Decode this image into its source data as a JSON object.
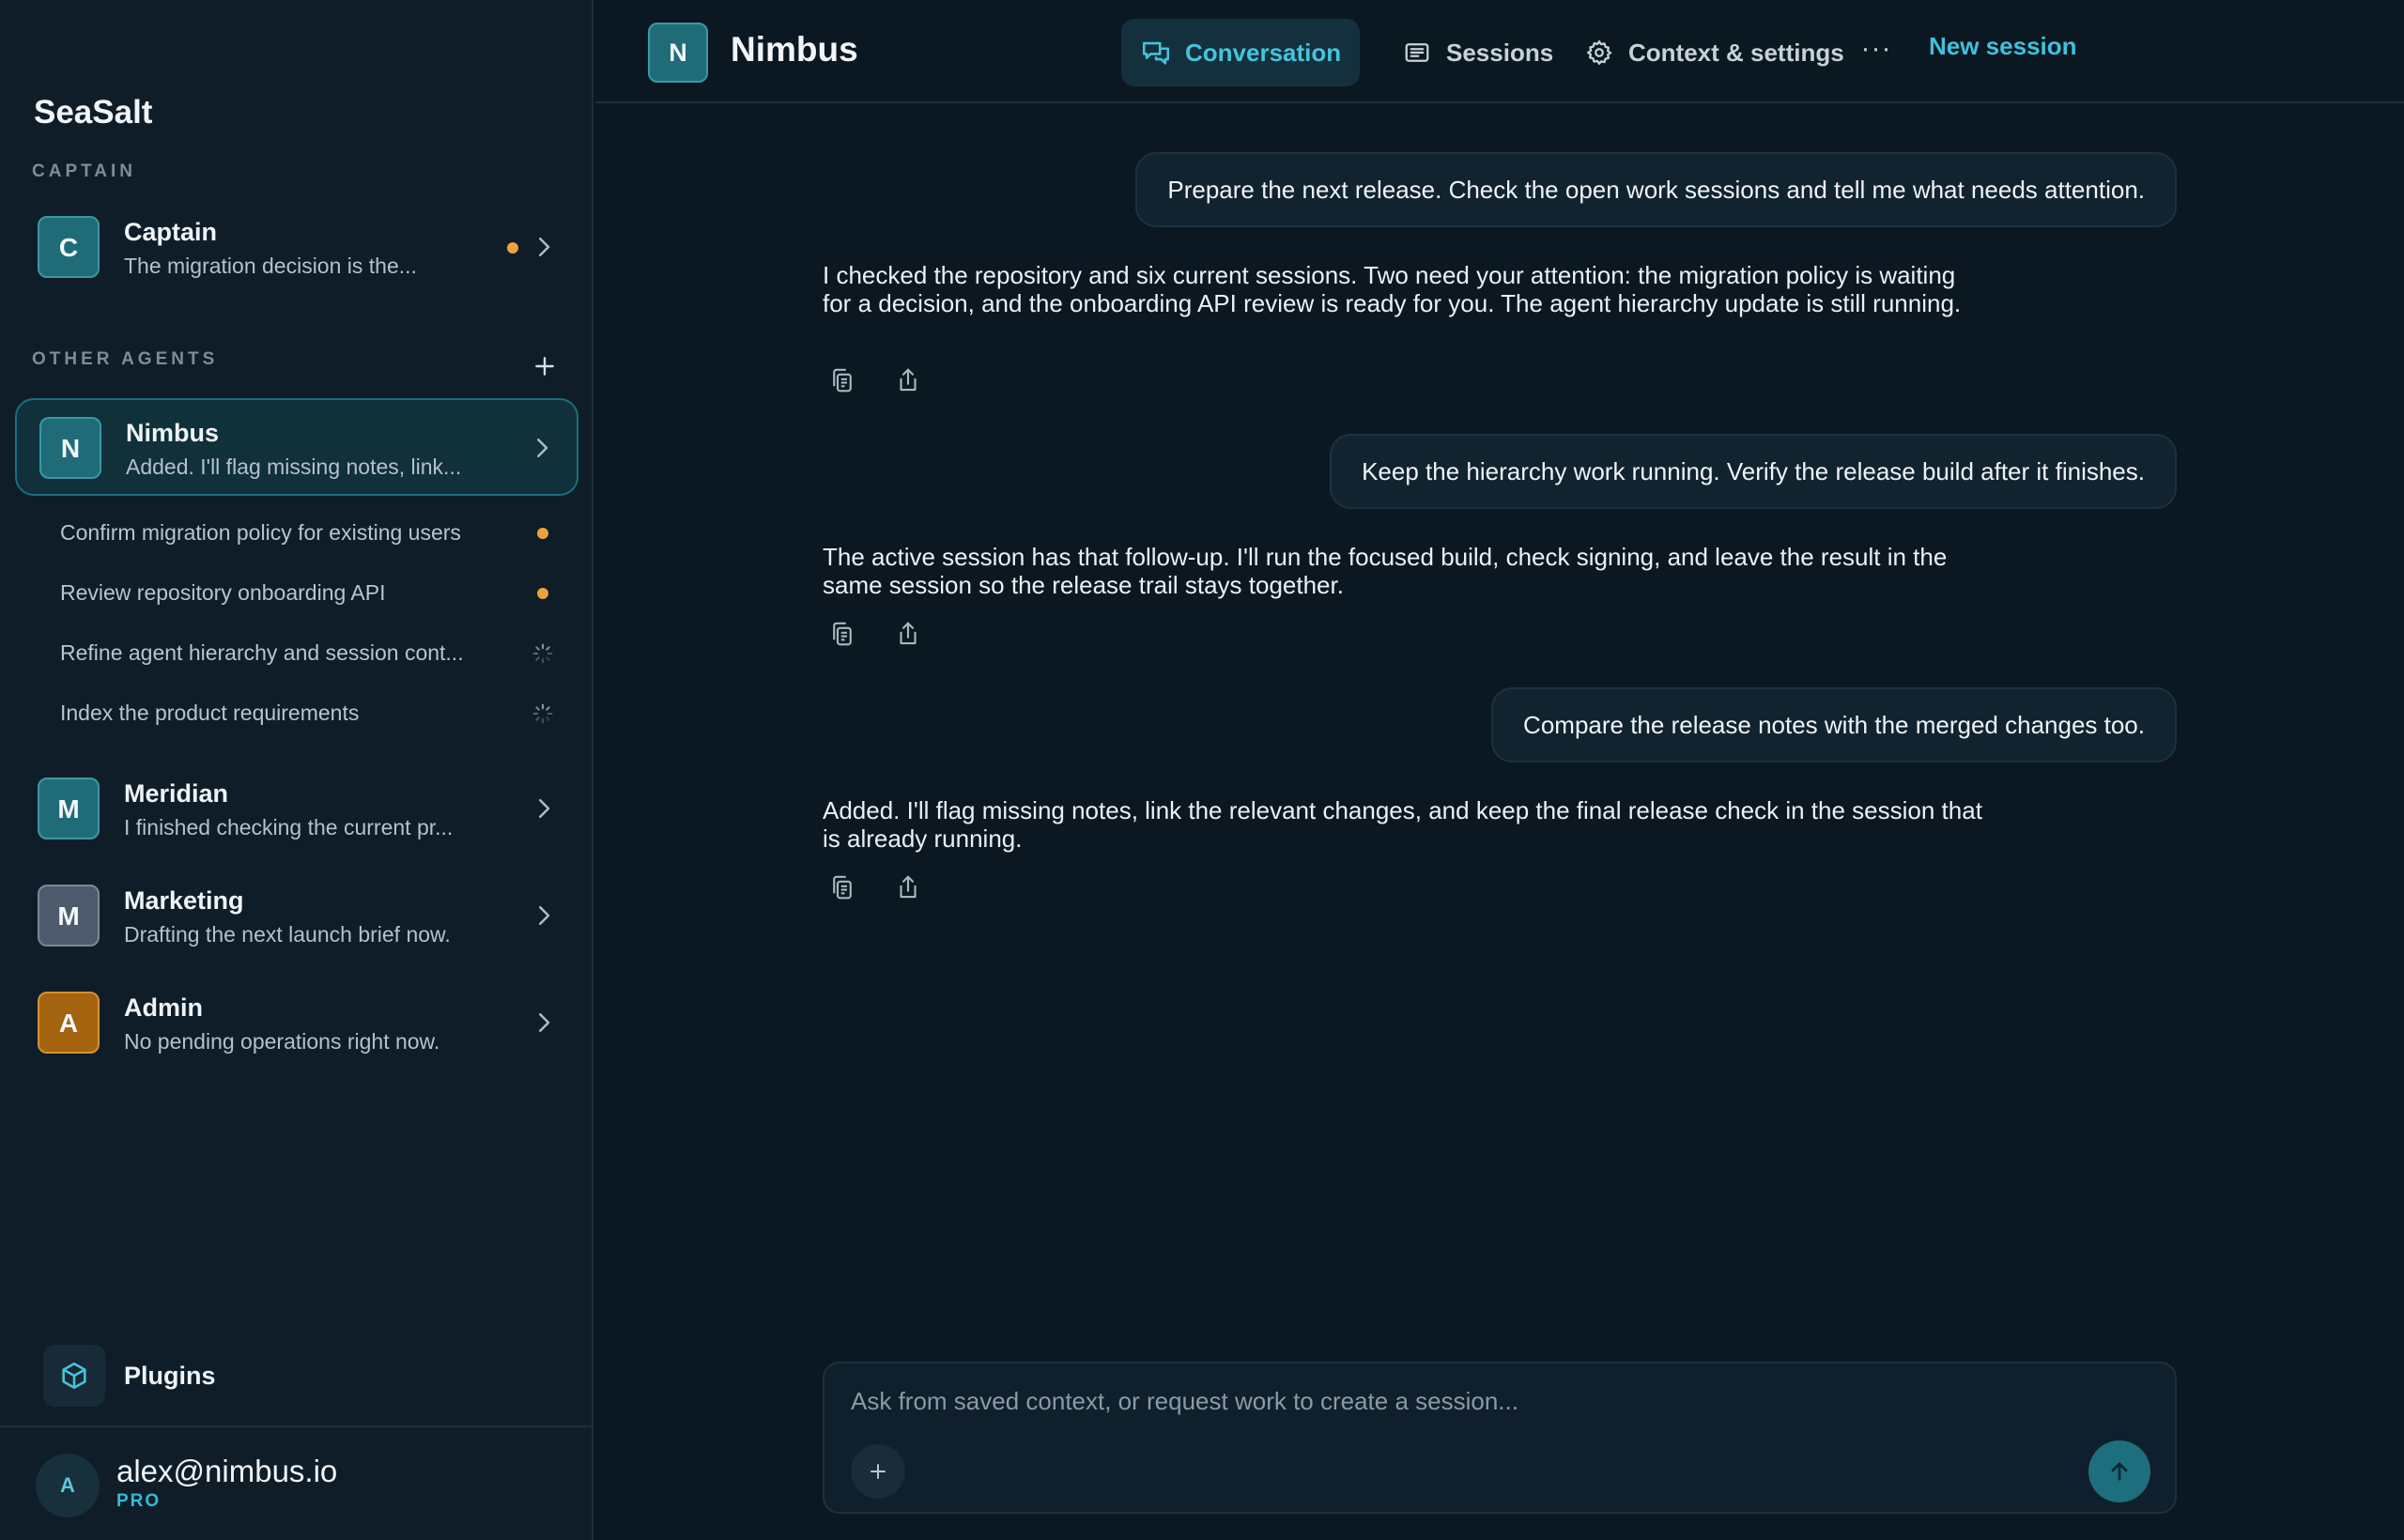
{
  "app": {
    "brand": "SeaSalt"
  },
  "sidebar": {
    "captain_label": "CAPTAIN",
    "captain": {
      "initial": "C",
      "name": "Captain",
      "preview": "The migration decision is the..."
    },
    "other_agents_label": "OTHER AGENTS",
    "agents": [
      {
        "initial": "N",
        "name": "Nimbus",
        "preview": "Added. I'll flag missing notes, link...",
        "active": true
      },
      {
        "initial": "M",
        "name": "Meridian",
        "preview": "I finished checking the current pr..."
      },
      {
        "initial": "M",
        "name": "Marketing",
        "preview": "Drafting the next launch brief now."
      },
      {
        "initial": "A",
        "name": "Admin",
        "preview": "No pending operations right now."
      }
    ],
    "sessions": [
      {
        "label": "Confirm migration policy for existing users",
        "status": "attention"
      },
      {
        "label": "Review repository onboarding API",
        "status": "attention"
      },
      {
        "label": "Refine agent hierarchy and session cont...",
        "status": "running"
      },
      {
        "label": "Index the product requirements",
        "status": "running"
      }
    ],
    "plugins_label": "Plugins",
    "user": {
      "initial": "A",
      "email": "alex@nimbus.io",
      "plan": "PRO"
    }
  },
  "header": {
    "initial": "N",
    "title": "Nimbus",
    "tabs": [
      {
        "label": "Conversation",
        "icon": "chat-bubbles-icon",
        "active": true
      },
      {
        "label": "Sessions",
        "icon": "list-icon"
      },
      {
        "label": "Context & settings",
        "icon": "gear-icon"
      }
    ],
    "more_label": "···",
    "new_session_label": "New session"
  },
  "conversation": {
    "messages": [
      {
        "role": "user",
        "text": "Prepare the next release. Check the open work sessions and tell me what needs attention."
      },
      {
        "role": "agent",
        "text": "I checked the repository and six current sessions. Two need your attention: the migration policy is waiting for a decision, and the onboarding API review is ready for you. The agent hierarchy update is still running."
      },
      {
        "role": "user",
        "text": "Keep the hierarchy work running. Verify the release build after it finishes."
      },
      {
        "role": "agent",
        "text": "The active session has that follow-up. I'll run the focused build, check signing, and leave the result in the same session so the release trail stays together."
      },
      {
        "role": "user",
        "text": "Compare the release notes with the merged changes too."
      },
      {
        "role": "agent",
        "text": "Added. I'll flag missing notes, link the relevant changes, and keep the final release check in the session that is already running."
      }
    ]
  },
  "composer": {
    "placeholder": "Ask from saved context, or request work to create a session...",
    "value": ""
  },
  "colors": {
    "accent": "#44c4dc",
    "attention_dot": "#f0a23a",
    "background": "#0b1822",
    "sidebar": "#0f1d29"
  }
}
